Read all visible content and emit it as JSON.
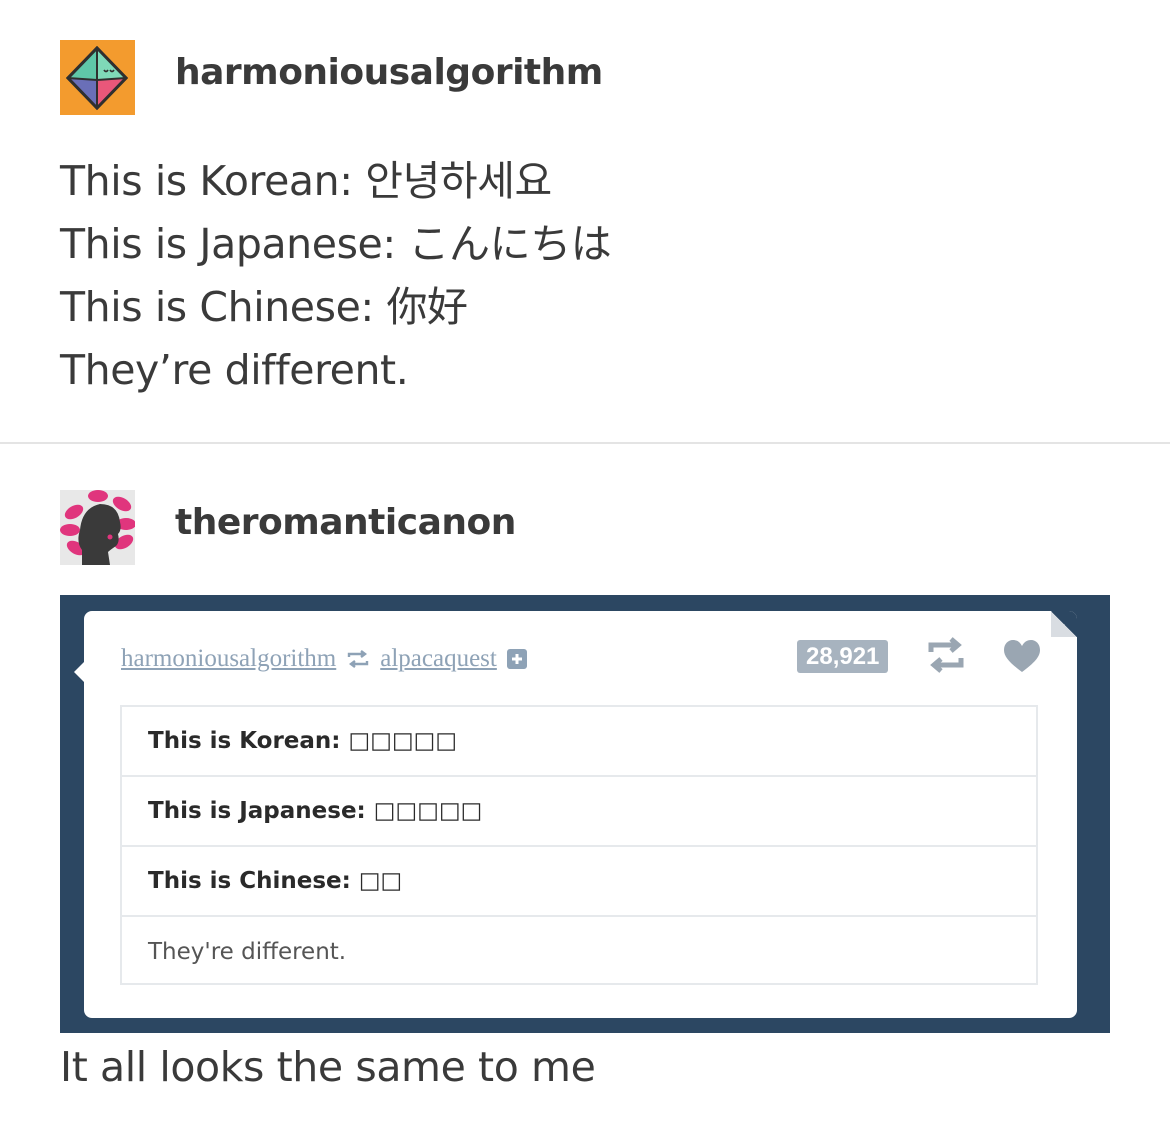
{
  "post1": {
    "username": "harmoniousalgorithm",
    "lines": [
      "This is Korean: 안녕하세요",
      "This is Japanese: こんにちは",
      "This is Chinese: 你好",
      "They’re different."
    ]
  },
  "post2": {
    "username": "theromanticanon",
    "embedded": {
      "trail_user_1": "harmoniousalgorithm",
      "trail_user_2": "alpacaquest",
      "note_count": "28,921",
      "rows": [
        "This is Korean: □□□□□",
        "This is Japanese: □□□□□",
        "This is Chinese: □□",
        "They're different."
      ]
    },
    "caption": "It all looks the same to me"
  },
  "colors": {
    "embed_background": "#2c4762",
    "trail_link": "#8ea2b6",
    "avatar1_background": "#f39b2e"
  },
  "icons": [
    "octahedron-avatar",
    "silhouette-avatar",
    "reblog-icon",
    "plus-icon",
    "heart-icon"
  ]
}
